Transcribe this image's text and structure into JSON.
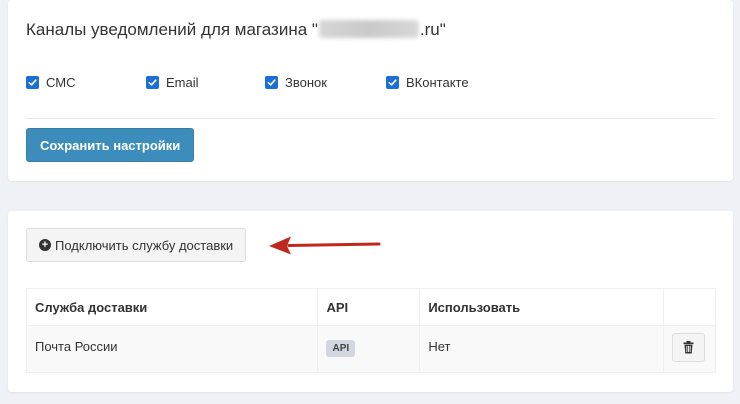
{
  "notifications": {
    "title_prefix": "Каналы уведомлений для магазина \"",
    "title_suffix": ".ru\"",
    "channels": [
      {
        "label": "СМС",
        "checked": true
      },
      {
        "label": "Email",
        "checked": true
      },
      {
        "label": "Звонок",
        "checked": true
      },
      {
        "label": "ВКонтакте",
        "checked": true
      }
    ],
    "save_label": "Сохранить настройки"
  },
  "delivery": {
    "connect_label": "Подключить службу доставки",
    "connect_icon": "plus-circle-icon",
    "arrow_color": "#c0281c",
    "table": {
      "headers": [
        "Служба доставки",
        "API",
        "Использовать",
        ""
      ],
      "rows": [
        {
          "service": "Почта России",
          "api": "API",
          "use": "Нет"
        }
      ]
    },
    "delete_icon": "trash-icon"
  },
  "colors": {
    "primary": "#3c8dbc",
    "checkbox": "#1a6fd8",
    "background": "#eef1f5"
  }
}
